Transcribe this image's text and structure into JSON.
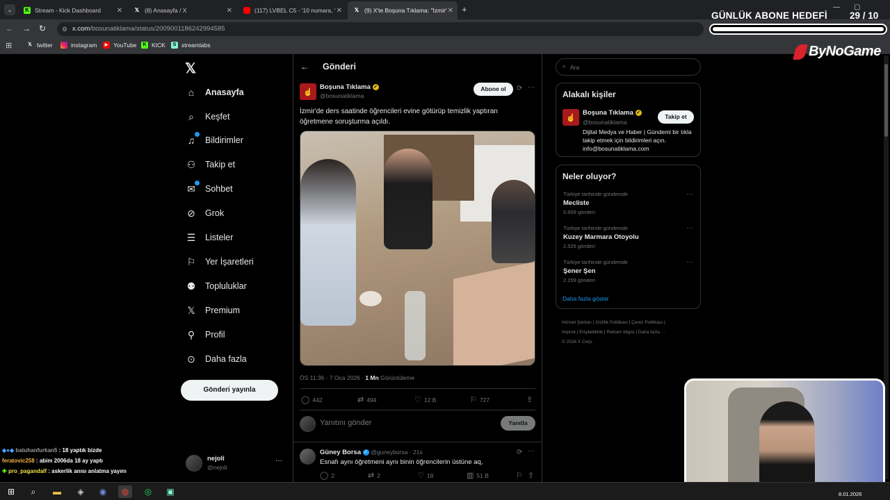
{
  "browser": {
    "tabs": [
      {
        "title": "Stream - Kick Dashboard",
        "icon": "kick-icon",
        "color": "#53fc18"
      },
      {
        "title": "(8) Anasayfa / X",
        "icon": "x-icon",
        "color": "#ffffff"
      },
      {
        "title": "(117) LVBEL C5 - '10 numara, '",
        "icon": "youtube-icon",
        "color": "#ff0000"
      },
      {
        "title": "(9) X'te Boşuna Tıklama: \"İzmir'",
        "icon": "x-icon",
        "color": "#ffffff"
      }
    ],
    "url_host": "x.com",
    "url_path": "/bosunatiklama/status/2009001186242994585",
    "bookmarks": [
      "twitter",
      "instagram",
      "YouTube",
      "KICK",
      "streamlabs"
    ]
  },
  "sidebar": {
    "items": [
      {
        "label": "Anasayfa",
        "icon": "home-icon"
      },
      {
        "label": "Keşfet",
        "icon": "search-icon"
      },
      {
        "label": "Bildirimler",
        "icon": "bell-icon"
      },
      {
        "label": "Takip et",
        "icon": "follow-icon"
      },
      {
        "label": "Sohbet",
        "icon": "mail-icon"
      },
      {
        "label": "Grok",
        "icon": "grok-icon"
      },
      {
        "label": "Listeler",
        "icon": "list-icon"
      },
      {
        "label": "Yer İşaretleri",
        "icon": "bookmark-icon"
      },
      {
        "label": "Topluluklar",
        "icon": "community-icon"
      },
      {
        "label": "Premium",
        "icon": "x-icon"
      },
      {
        "label": "Profil",
        "icon": "profile-icon"
      },
      {
        "label": "Daha fazla",
        "icon": "more-icon"
      }
    ],
    "post_button": "Gönderi yayınla",
    "account": {
      "name": "nejoli",
      "handle": "@nejoli"
    }
  },
  "post": {
    "header": "Gönderi",
    "author_name": "Boşuna Tıklama",
    "author_handle": "@bosunatiklama",
    "follow_label": "Abone ol",
    "text": "İzmir'de ders saatinde öğrencileri evine götürüp temizlik yaptıran öğretmene soruşturma açıldı.",
    "time": "ÖS 11:36 · 7 Oca 2026 · ",
    "views_count": "1 Mn",
    "views_label": " Görüntüleme",
    "replies": "442",
    "reposts": "494",
    "likes": "12 B",
    "bookmarks": "727",
    "reply_placeholder": "Yanıtını gönder",
    "reply_button": "Yanıtla"
  },
  "reply": {
    "name": "Güney Borsa",
    "handle": "@guneyborsa · 21s",
    "text": "Esnafı aynı öğretmeni aynı binin öğrencilerin üstüne aq,",
    "replies": "2",
    "reposts": "2",
    "likes": "18",
    "views": "51 B"
  },
  "right": {
    "search_placeholder": "Ara",
    "relevant_title": "Alakalı kişiler",
    "person_name": "Boşuna Tıklama",
    "person_handle": "@bosunatiklama",
    "person_follow": "Takip et",
    "person_bio": "Dijital Medya ve Haber | Gündemi bir tıkla takip etmek için bildirimleri açın. info@bosunatiklama.com",
    "trends_title": "Neler oluyor?",
    "trends": [
      {
        "category": "Türkiye tarihinde gündemde",
        "name": "Mecliste",
        "count": "5.959 gönderi"
      },
      {
        "category": "Türkiye tarihinde gündemde",
        "name": "Kuzey Marmara Otoyolu",
        "count": "2.526 gönderi"
      },
      {
        "category": "Türkiye tarihinde gündemde",
        "name": "Şener Şen",
        "count": "2.159 gönderi"
      }
    ],
    "show_more": "Daha fazla göster",
    "footer_line1": "Hizmet Şartları  |  Gizlilik Politikası  |  Çerez Politikası  |",
    "footer_line2": "Imprint  |  Erişilebilirlik  |  Reklam bilgisi  |  Daha fazla ···",
    "footer_line3": "© 2026 X Corp."
  },
  "overlay": {
    "goal_title": "GÜNLÜK ABONE HEDEFİ",
    "goal_current": "29",
    "goal_sep": "/ 10",
    "goal_progress": 1.0,
    "brand": "ByNoGame",
    "chat": [
      {
        "user": "batuhanfurkan5",
        "text": " : 18 yaptık bizde",
        "color": "#9a9a9a"
      },
      {
        "user": "feratovic258",
        "text": " : abim 2006da 18 ay yaptı",
        "color": "#f5b342"
      },
      {
        "user": "pro_pagandalf",
        "text": " : askerlik anısı anlatma yayını",
        "color": "#f5e342"
      }
    ]
  },
  "taskbar": {
    "date": "8.01.2026"
  }
}
